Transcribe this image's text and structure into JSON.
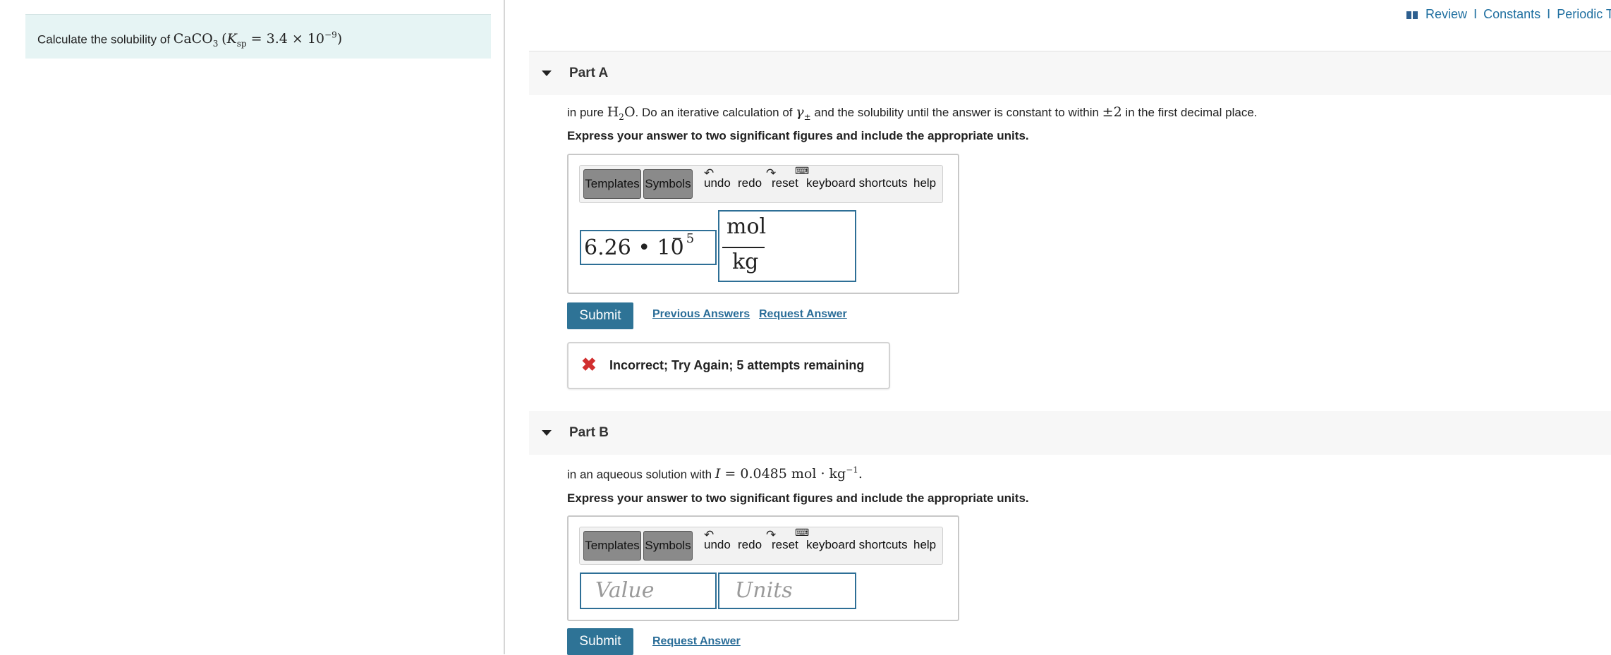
{
  "top_links": {
    "review": "Review",
    "constants": "Constants",
    "periodic_table": "Periodic Table",
    "separator": "I"
  },
  "problem": {
    "prefix": "Calculate the solubility of",
    "compound": "CaCO",
    "compound_sub": "3",
    "ksp_label": "K",
    "ksp_sub": "sp",
    "ksp_value": "= 3.4 × 10",
    "ksp_exp": "−9"
  },
  "toolbar": {
    "templates": "Templates",
    "symbols": "Symbols",
    "undo": "undo",
    "redo": "redo",
    "reset": "reset",
    "keyboard_shortcuts": "keyboard shortcuts",
    "help": "help"
  },
  "partA": {
    "title": "Part A",
    "question_prefix": "in pure",
    "question_formula": "H",
    "question_formula_sub": "2",
    "question_formula_end": "O",
    "question_middle": ". Do an iterative calculation of",
    "gamma": "γ",
    "gamma_sub": "±",
    "question_end": "and the solubility until the answer is constant to within",
    "pm": "±2",
    "question_tail": "in the first decimal place.",
    "instructions": "Express your answer to two significant figures and include the appropriate units.",
    "value": "6.26 • 10",
    "value_exp": "− 5",
    "unit_num": "mol",
    "unit_den": "kg",
    "submit": "Submit",
    "previous_answers": "Previous Answers",
    "request_answer": "Request Answer",
    "feedback": "Incorrect; Try Again; 5 attempts remaining"
  },
  "partB": {
    "title": "Part B",
    "question_prefix": "in an aqueous solution with",
    "I_symbol": "I",
    "I_value": "= 0.0485 mol · kg",
    "I_exp": "−1",
    "I_end": ".",
    "instructions": "Express your answer to two significant figures and include the appropriate units.",
    "value_placeholder": "Value",
    "units_placeholder": "Units",
    "submit": "Submit",
    "request_answer": "Request Answer"
  },
  "colors": {
    "accent": "#2e7396",
    "problem_bg": "#e6f4f4",
    "error": "#d12f2f",
    "link": "#2a6d98"
  }
}
